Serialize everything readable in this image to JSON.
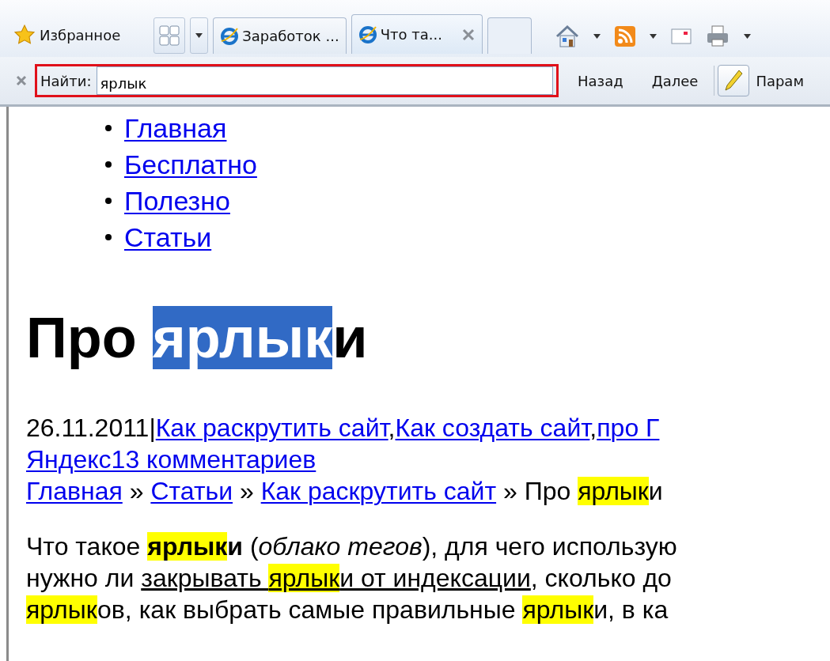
{
  "toolbar": {
    "favorites": "Избранное",
    "tabs": [
      {
        "label": "Заработок ...",
        "selected": false,
        "closable": false
      },
      {
        "label": "Что та...",
        "selected": true,
        "closable": true
      }
    ]
  },
  "find_bar": {
    "label": "Найти:",
    "value": "ярлык",
    "buttons": [
      "Назад",
      "Далее"
    ],
    "options": "Парам"
  },
  "nav": [
    {
      "label": "Главная"
    },
    {
      "label": "Бесплатно"
    },
    {
      "label": "Полезно"
    },
    {
      "label": "Статьи"
    }
  ],
  "heading": [
    {
      "text": "Про ",
      "highlight": false
    },
    {
      "text": "ярлык",
      "highlight": true
    },
    {
      "text": "и",
      "highlight": false
    }
  ],
  "meta": {
    "date": "26.11.2011|",
    "separator": ",",
    "links": [
      "Как раскрутить сайт",
      "Как создать сайт",
      "про Г"
    ],
    "comments": "Яндекс13 комментариев"
  },
  "breadcrumbs": {
    "links": [
      "Главная",
      "Статьи",
      "Как раскрутить сайт"
    ],
    "separator": "»",
    "current": [
      {
        "text": "Про ",
        "highlight": false
      },
      {
        "text": "ярлык",
        "highlight": true
      },
      {
        "text": "и",
        "highlight": false
      }
    ]
  },
  "paragraph": [
    [
      {
        "text": "Что такое ",
        "highlight": false,
        "bold": false,
        "italic": false,
        "underline": false
      },
      {
        "text": "ярлык",
        "highlight": true,
        "bold": true,
        "italic": false,
        "underline": false
      },
      {
        "text": "и",
        "highlight": false,
        "bold": true,
        "italic": false,
        "underline": false
      },
      {
        "text": " (",
        "highlight": false,
        "bold": false,
        "italic": false,
        "underline": false
      },
      {
        "text": "облако тегов",
        "highlight": false,
        "bold": false,
        "italic": true,
        "underline": false
      },
      {
        "text": "), для чего использую",
        "highlight": false,
        "bold": false,
        "italic": false,
        "underline": false
      }
    ],
    [
      {
        "text": "нужно ли ",
        "highlight": false,
        "bold": false,
        "italic": false,
        "underline": false
      },
      {
        "text": "закрывать ",
        "highlight": false,
        "bold": false,
        "italic": false,
        "underline": true
      },
      {
        "text": "ярлык",
        "highlight": true,
        "bold": false,
        "italic": false,
        "underline": true
      },
      {
        "text": "и от индексации",
        "highlight": false,
        "bold": false,
        "italic": false,
        "underline": true
      },
      {
        "text": ", сколько до",
        "highlight": false,
        "bold": false,
        "italic": false,
        "underline": false
      }
    ],
    [
      {
        "text": "ярлык",
        "highlight": true,
        "bold": false,
        "italic": false,
        "underline": false
      },
      {
        "text": "ов, как выбрать самые правильные ",
        "highlight": false,
        "bold": false,
        "italic": false,
        "underline": false
      },
      {
        "text": "ярлык",
        "highlight": true,
        "bold": false,
        "italic": false,
        "underline": false
      },
      {
        "text": "и, в ка",
        "highlight": false,
        "bold": false,
        "italic": false,
        "underline": false
      }
    ]
  ]
}
